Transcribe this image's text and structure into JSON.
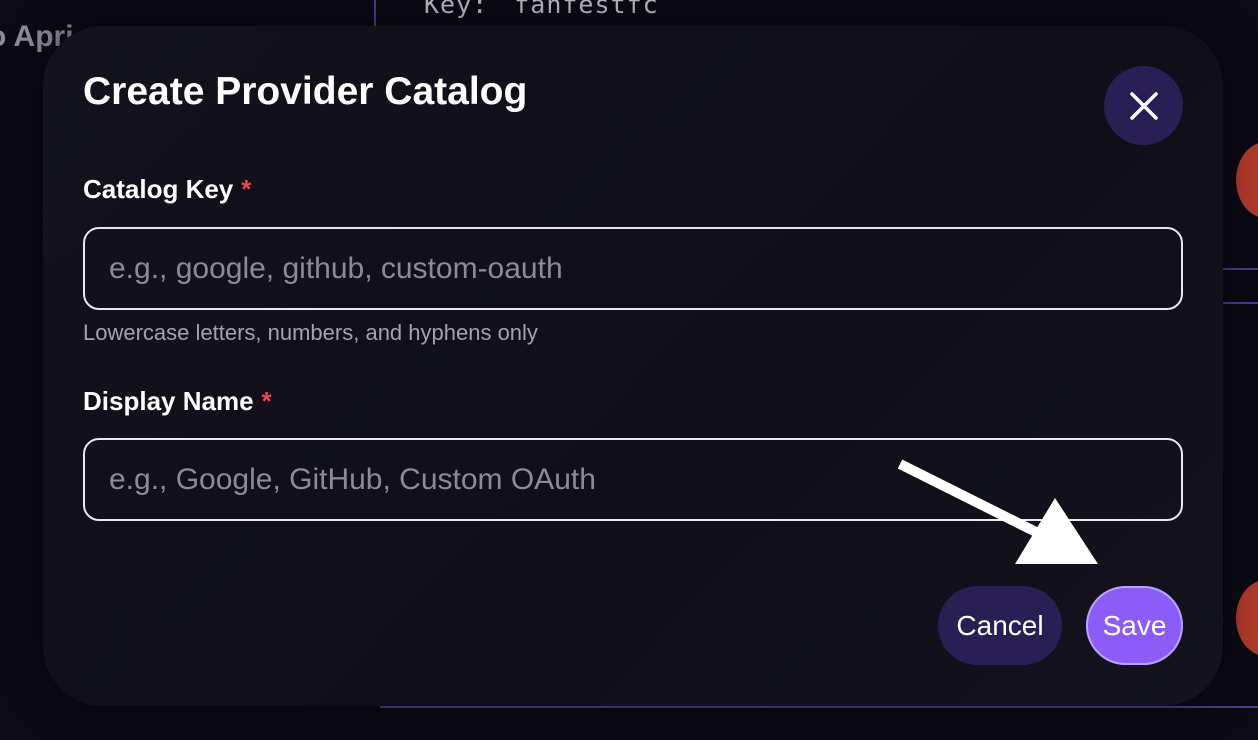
{
  "background": {
    "key_label": "Key:",
    "key_value": "fanfestfc",
    "partial_text": "o Apri"
  },
  "modal": {
    "title": "Create Provider Catalog",
    "close_icon": "close-icon",
    "fields": {
      "catalog_key": {
        "label": "Catalog Key",
        "required_marker": "*",
        "placeholder": "e.g., google, github, custom-oauth",
        "value": "",
        "hint": "Lowercase letters, numbers, and hyphens only"
      },
      "display_name": {
        "label": "Display Name",
        "required_marker": "*",
        "placeholder": "e.g., Google, GitHub, Custom OAuth",
        "value": ""
      }
    },
    "buttons": {
      "cancel": "Cancel",
      "save": "Save"
    }
  },
  "annotation": {
    "arrow_icon": "arrow-icon"
  },
  "colors": {
    "accent": "#8b5cf6",
    "secondary_button": "#2a1f55",
    "required": "#e5484d",
    "background": "#0b0a14",
    "modal": "#13121c"
  }
}
